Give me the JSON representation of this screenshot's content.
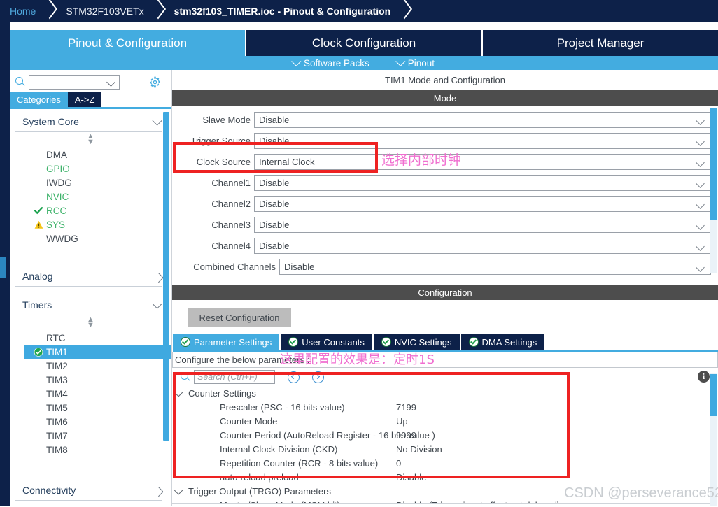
{
  "breadcrumb": {
    "home": "Home",
    "device": "STM32F103VETx",
    "current": "stm32f103_TIMER.ioc - Pinout & Configuration"
  },
  "main_tabs": [
    {
      "label": "Pinout & Configuration",
      "active": true
    },
    {
      "label": "Clock Configuration",
      "active": false
    },
    {
      "label": "Project Manager",
      "active": false
    }
  ],
  "sub_tabs": [
    {
      "label": "Software Packs",
      "icon": "chevron-down-icon"
    },
    {
      "label": "Pinout",
      "icon": "chevron-down-icon"
    }
  ],
  "sidebar": {
    "search_value": "",
    "gear_icon": "gear-icon",
    "search_icon": "search-icon",
    "view_tabs": [
      {
        "label": "Categories",
        "active": true
      },
      {
        "label": "A->Z",
        "active": false
      }
    ],
    "groups": [
      {
        "label": "System Core",
        "expanded": true,
        "items": [
          {
            "label": "DMA",
            "state": "none",
            "badge": ""
          },
          {
            "label": "GPIO",
            "state": "green",
            "badge": ""
          },
          {
            "label": "IWDG",
            "state": "none",
            "badge": ""
          },
          {
            "label": "NVIC",
            "state": "green",
            "badge": ""
          },
          {
            "label": "RCC",
            "state": "green",
            "badge": "check-icon"
          },
          {
            "label": "SYS",
            "state": "green",
            "badge": "warning-icon"
          },
          {
            "label": "WWDG",
            "state": "none",
            "badge": ""
          }
        ]
      },
      {
        "label": "Analog",
        "expanded": false,
        "items": []
      },
      {
        "label": "Timers",
        "expanded": true,
        "items": [
          {
            "label": "RTC",
            "state": "none",
            "badge": ""
          },
          {
            "label": "TIM1",
            "state": "selected",
            "badge": "check-circle-icon"
          },
          {
            "label": "TIM2",
            "state": "none",
            "badge": ""
          },
          {
            "label": "TIM3",
            "state": "none",
            "badge": ""
          },
          {
            "label": "TIM4",
            "state": "none",
            "badge": ""
          },
          {
            "label": "TIM5",
            "state": "none",
            "badge": ""
          },
          {
            "label": "TIM6",
            "state": "none",
            "badge": ""
          },
          {
            "label": "TIM7",
            "state": "none",
            "badge": ""
          },
          {
            "label": "TIM8",
            "state": "none",
            "badge": ""
          }
        ]
      },
      {
        "label": "Connectivity",
        "expanded": false,
        "items": []
      }
    ]
  },
  "panel": {
    "title": "TIM1 Mode and Configuration",
    "mode_header": "Mode",
    "config_header": "Configuration",
    "mode_fields": [
      {
        "label": "Slave Mode",
        "value": "Disable",
        "label_w": 88
      },
      {
        "label": "Trigger Source",
        "value": "Disable",
        "label_w": 88
      },
      {
        "label": "Clock Source",
        "value": "Internal Clock",
        "label_w": 88
      },
      {
        "label": "Channel1",
        "value": "Disable",
        "label_w": 88
      },
      {
        "label": "Channel2",
        "value": "Disable",
        "label_w": 88
      },
      {
        "label": "Channel3",
        "value": "Disable",
        "label_w": 88
      },
      {
        "label": "Channel4",
        "value": "Disable",
        "label_w": 88
      },
      {
        "label": "Combined Channels",
        "value": "Disable",
        "label_w": 124
      }
    ],
    "reset_button": "Reset Configuration",
    "config_tabs": [
      {
        "label": "Parameter Settings",
        "active": true
      },
      {
        "label": "User Constants",
        "active": false
      },
      {
        "label": "NVIC Settings",
        "active": false
      },
      {
        "label": "DMA Settings",
        "active": false
      }
    ],
    "config_note": "Configure the below parameters :",
    "search_placeholder": "Search (Ctrl+F)",
    "search_value": "",
    "info_icon": "info-icon",
    "param_groups": [
      {
        "label": "Counter Settings",
        "rows": [
          {
            "name": "Prescaler (PSC - 16 bits value)",
            "value": "7199"
          },
          {
            "name": "Counter Mode",
            "value": "Up"
          },
          {
            "name": "Counter Period (AutoReload Register - 16 bits value )",
            "value": "9999"
          },
          {
            "name": "Internal Clock Division (CKD)",
            "value": "No Division"
          },
          {
            "name": "Repetition Counter (RCR - 8 bits value)",
            "value": "0"
          },
          {
            "name": "auto-reload preload",
            "value": "Disable"
          }
        ]
      },
      {
        "label": "Trigger Output (TRGO) Parameters",
        "rows": [
          {
            "name": "Master/Slave Mode (MSM bit)",
            "value": "Disable (Trigger input effect not delayed)"
          }
        ]
      }
    ]
  },
  "annotations": [
    {
      "id": "clock-source-note",
      "text": "选择内部时钟"
    },
    {
      "id": "timer-effect-note",
      "text": "这里配置的效果是：定时1S"
    }
  ],
  "watermark": "CSDN @perseverance52",
  "colors": {
    "accent": "#43ace0",
    "navy": "#0d2149",
    "section_gray": "#4d4d4d",
    "annotation_red": "#ee2222",
    "annotation_pink": "#f06fd0",
    "green": "#3fb36b"
  }
}
